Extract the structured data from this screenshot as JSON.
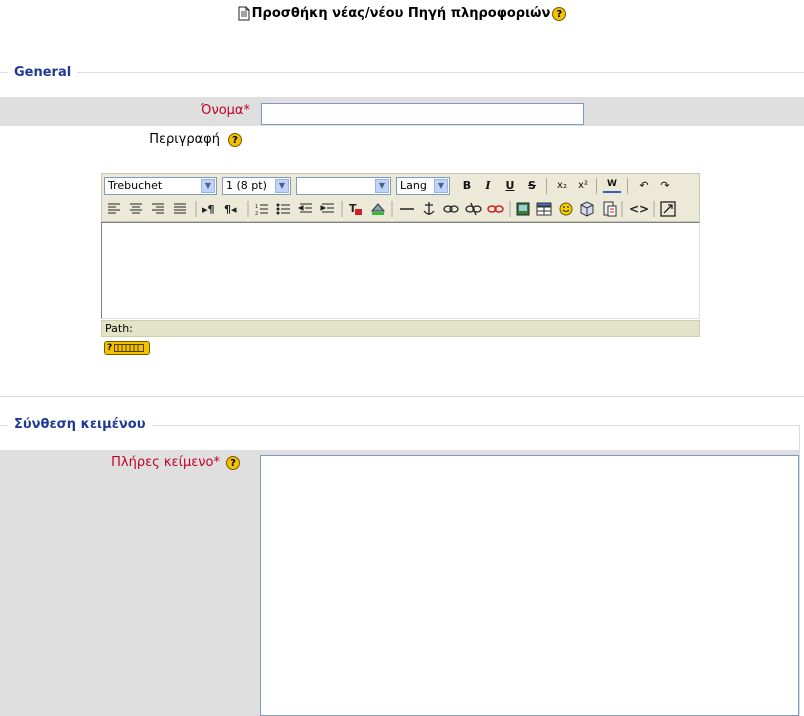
{
  "page": {
    "title": "Προσθήκη νέας/νέου Πηγή πληροφοριών",
    "title_icon": "document-icon",
    "help_glyph": "?"
  },
  "general": {
    "legend": "General",
    "name_label": "Όνομα",
    "name_value": "",
    "required_mark": "*",
    "description_label": "Περιγραφή"
  },
  "editor": {
    "font_select": "Trebuchet",
    "size_select": "1 (8 pt)",
    "format_select": "",
    "lang_select": "Lang",
    "row1_buttons": [
      "B",
      "I",
      "U",
      "S",
      "x₂",
      "x²",
      "W",
      "↶",
      "↷"
    ],
    "row2_buttons": [
      "align-left",
      "align-center",
      "align-right",
      "justify",
      "ltr",
      "rtl",
      "ordered-list",
      "unordered-list",
      "outdent",
      "indent",
      "text-color",
      "bg-color",
      "hr",
      "anchor",
      "link",
      "unlink",
      "nolink",
      "image",
      "table",
      "smiley",
      "special-char",
      "paste-word",
      "html-source",
      "fullscreen"
    ],
    "path_label": "Path:",
    "content": ""
  },
  "composition": {
    "legend": "Σύνθεση κειμένου",
    "fulltext_label": "Πλήρες κείμενο",
    "required_mark": "*",
    "fulltext_value": ""
  },
  "colors": {
    "legend": "#1f3a93",
    "required": "#c0002b",
    "row_bg": "#dfdfdf",
    "toolbar_bg": "#ece9d8"
  }
}
